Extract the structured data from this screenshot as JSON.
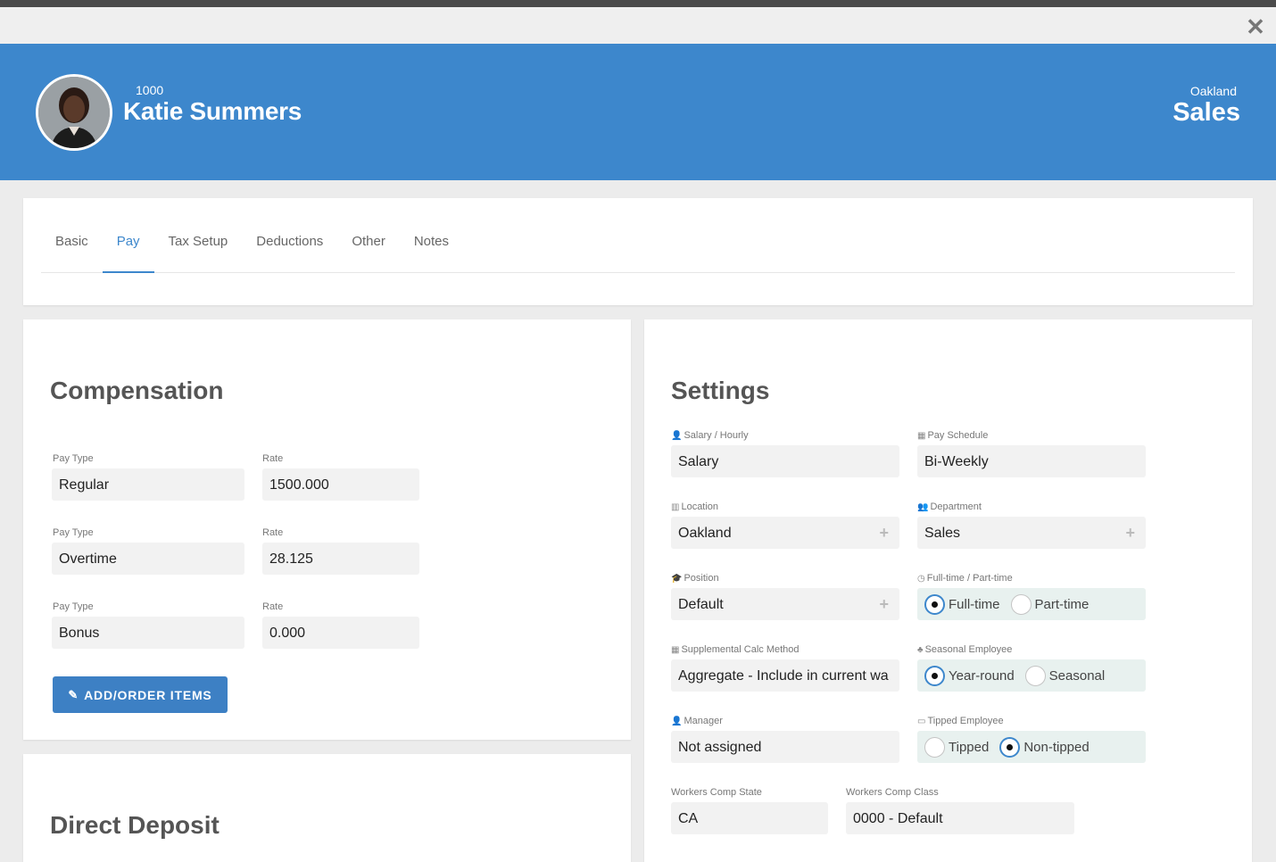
{
  "window": {
    "close_icon": "close-icon"
  },
  "header": {
    "employee_id": "1000",
    "employee_name": "Katie Summers",
    "location": "Oakland",
    "department": "Sales",
    "banner_color": "#3d87cc"
  },
  "tabs": [
    {
      "label": "Basic"
    },
    {
      "label": "Pay",
      "active": true
    },
    {
      "label": "Tax Setup"
    },
    {
      "label": "Deductions"
    },
    {
      "label": "Other"
    },
    {
      "label": "Notes"
    }
  ],
  "compensation": {
    "title": "Compensation",
    "rows": [
      {
        "pay_type_label": "Pay Type",
        "pay_type": "Regular",
        "rate_label": "Rate",
        "rate": "1500.000"
      },
      {
        "pay_type_label": "Pay Type",
        "pay_type": "Overtime",
        "rate_label": "Rate",
        "rate": "28.125"
      },
      {
        "pay_type_label": "Pay Type",
        "pay_type": "Bonus",
        "rate_label": "Rate",
        "rate": "0.000"
      }
    ],
    "add_button": "ADD/ORDER ITEMS"
  },
  "direct_deposit": {
    "title": "Direct Deposit"
  },
  "settings": {
    "title": "Settings",
    "salary_hourly": {
      "label": "Salary / Hourly",
      "value": "Salary",
      "icon": "user-icon"
    },
    "pay_schedule": {
      "label": "Pay Schedule",
      "value": "Bi-Weekly",
      "icon": "calendar-icon"
    },
    "location": {
      "label": "Location",
      "value": "Oakland",
      "icon": "building-icon"
    },
    "department": {
      "label": "Department",
      "value": "Sales",
      "icon": "users-icon"
    },
    "position": {
      "label": "Position",
      "value": "Default",
      "icon": "graduation-cap-icon"
    },
    "full_part_time": {
      "label": "Full-time / Part-time",
      "icon": "clock-icon",
      "options": [
        "Full-time",
        "Part-time"
      ],
      "selected": "Full-time"
    },
    "supplemental": {
      "label": "Supplemental Calc Method",
      "value": "Aggregate - Include in current wa",
      "icon": "calculator-icon"
    },
    "seasonal": {
      "label": "Seasonal Employee",
      "icon": "tree-icon",
      "options": [
        "Year-round",
        "Seasonal"
      ],
      "selected": "Year-round"
    },
    "manager": {
      "label": "Manager",
      "value": "Not assigned",
      "icon": "user-icon"
    },
    "tipped": {
      "label": "Tipped Employee",
      "icon": "money-icon",
      "options": [
        "Tipped",
        "Non-tipped"
      ],
      "selected": "Non-tipped"
    },
    "wc_state": {
      "label": "Workers Comp State",
      "value": "CA"
    },
    "wc_class": {
      "label": "Workers Comp Class",
      "value": "0000 - Default"
    }
  }
}
